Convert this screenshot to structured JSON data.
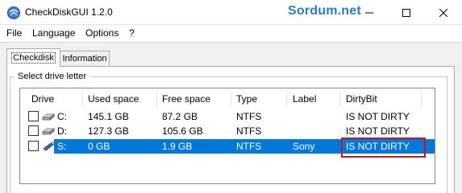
{
  "window": {
    "title": "CheckDiskGUI 1.2.0",
    "watermark": "Sordum.net",
    "controls": [
      "minimize",
      "maximize",
      "close"
    ]
  },
  "menu": [
    "File",
    "Language",
    "Options",
    "?"
  ],
  "tabs": [
    {
      "label": "Checkdisk",
      "active": true
    },
    {
      "label": "Information",
      "active": false
    }
  ],
  "group": {
    "label": "Select drive letter"
  },
  "table": {
    "columns": [
      "Drive",
      "Used space",
      "Free space",
      "Type",
      "Label",
      "DirtyBit"
    ],
    "rows": [
      {
        "drive": "C:",
        "used": "145.1 GB",
        "free": "87.2 GB",
        "type": "NTFS",
        "label": "",
        "dirty": "IS NOT DIRTY",
        "checked": false,
        "selected": false,
        "icon": "hard-drive-icon"
      },
      {
        "drive": "D:",
        "used": "127.3 GB",
        "free": "105.6 GB",
        "type": "NTFS",
        "label": "",
        "dirty": "IS NOT DIRTY",
        "checked": false,
        "selected": false,
        "icon": "hard-drive-icon"
      },
      {
        "drive": "S:",
        "used": "0 GB",
        "free": "1.9 GB",
        "type": "NTFS",
        "label": "Sony",
        "dirty": "IS NOT DIRTY",
        "checked": false,
        "selected": true,
        "icon": "usb-drive-icon"
      }
    ]
  },
  "colors": {
    "selection": "#0078d7",
    "highlight_border": "#c4161c",
    "watermark": "#2a7bc6"
  }
}
